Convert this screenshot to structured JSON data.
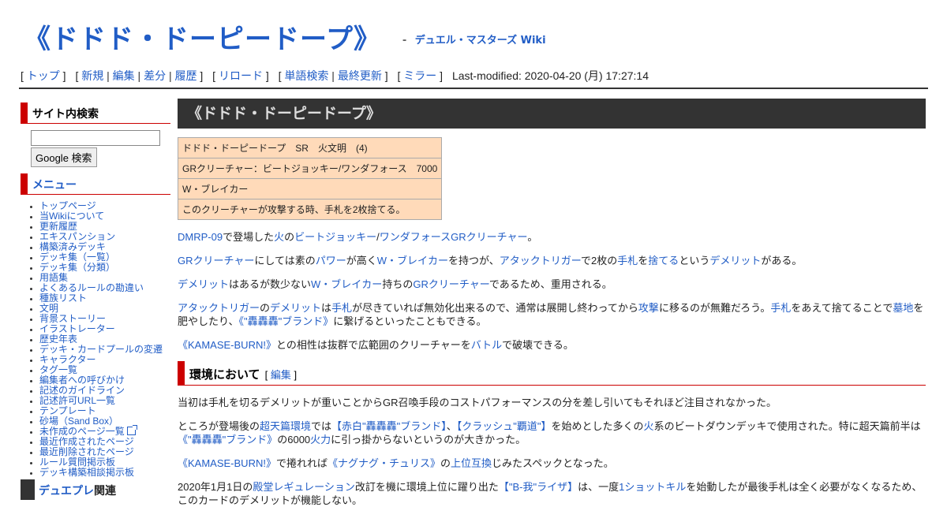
{
  "site": {
    "page_title": "《ドドド・ドーピードープ》",
    "dash": "-",
    "wiki_name": "デュエル・マスターズ Wiki"
  },
  "navbar": {
    "top": "トップ",
    "new": "新規",
    "edit": "編集",
    "diff": "差分",
    "history": "履歴",
    "reload": "リロード",
    "word_search": "単語検索",
    "recent": "最終更新",
    "mirror": "ミラー",
    "last_modified": "Last-modified: 2020-04-20 (月) 17:27:14"
  },
  "sidebar": {
    "search_heading": "サイト内検索",
    "search_value": "",
    "search_button": "Google 検索",
    "menu_heading": "メニュー",
    "menu_items": [
      "トップページ",
      "当Wikiについて",
      "更新履歴",
      "エキスパンション",
      "構築済みデッキ",
      "デッキ集（一覧）",
      "デッキ集（分類）",
      "用語集",
      "よくあるルールの勘違い",
      "種族リスト",
      "文明",
      "背景ストーリー",
      "イラストレーター",
      "歴史年表",
      "デッキ・カードプールの変遷",
      "キャラクター",
      "タグ一覧",
      "編集者への呼びかけ",
      "記述のガイドライン",
      "記述許可URL一覧",
      "テンプレート",
      "砂場（Sand Box）",
      "未作成のページ一覧",
      "最近作成されたページ",
      "最近削除されたページ",
      "ルール質問掲示板",
      "デッキ構築相談掲示板"
    ],
    "related_link": "デュエプレ",
    "related_suffix": "関連"
  },
  "main": {
    "heading": "《ドドド・ドーピードープ》",
    "card_rows": [
      "ドドド・ドーピードープ　SR　火文明　(4)",
      "GRクリーチャー：ビートジョッキー/ワンダフォース　7000",
      "W・ブレイカー",
      "このクリーチャーが攻撃する時、手札を2枚捨てる。"
    ],
    "p1": {
      "a1": "DMRP-09",
      "t1": "で登場した",
      "a2": "火",
      "t2": "の",
      "a3": "ビートジョッキー",
      "t3": "/",
      "a4": "ワンダフォース",
      "a5": "GRクリーチャー",
      "t4": "。"
    },
    "p2": {
      "a1": "GRクリーチャー",
      "t1": "にしては素の",
      "a2": "パワー",
      "t2": "が高く",
      "a3": "W・ブレイカー",
      "t3": "を持つが、",
      "a4": "アタックトリガー",
      "t4": "で2枚の",
      "a5": "手札",
      "t5": "を",
      "a6": "捨てる",
      "t6": "という",
      "a7": "デメリット",
      "t7": "がある。"
    },
    "p3": {
      "a1": "デメリット",
      "t1": "はあるが数少ない",
      "a2": "W・ブレイカー",
      "t2": "持ちの",
      "a3": "GRクリーチャー",
      "t3": "であるため、重用される。"
    },
    "p4": {
      "a1": "アタックトリガー",
      "t1": "の",
      "a2": "デメリット",
      "t2": "は",
      "a3": "手札",
      "t3": "が尽きていれば無効化出来るので、通常は展開し終わってから",
      "a4": "攻撃",
      "t4": "に移るのが無難だろう。",
      "a5": "手札",
      "t5": "をあえて捨てることで",
      "a6": "墓地",
      "t6": "を肥やしたり、",
      "a7": "《\"轟轟轟\"ブランド》",
      "t7": "に繋げるといったこともできる。"
    },
    "p5": {
      "a1": "《KAMASE-BURN!》",
      "t1": "との相性は抜群で広範囲のクリーチャーを",
      "a2": "バトル",
      "t2": "で破壊できる。"
    },
    "section": {
      "title": "環境において",
      "edit_open": "[",
      "edit_label": "編集",
      "edit_close": "]"
    },
    "s1": "当初は手札を切るデメリットが重いことからGR召喚手段のコストパフォーマンスの分を差し引いてもそれほど注目されなかった。",
    "s2": {
      "t1": "ところが登場後の",
      "a1": "超天篇環境",
      "t2": "では",
      "a2": "【赤白\"轟轟轟\"ブランド】",
      "t3": "、",
      "a3": "【クラッシュ\"覇道\"】",
      "t4": "を始めとした多くの",
      "a4": "火",
      "t5": "系のビートダウンデッキで使用された。特に超天篇前半は",
      "a5": "《\"轟轟轟\"ブランド》",
      "t6": "の6000",
      "a6": "火力",
      "t7": "に引っ掛からないというのが大きかった。"
    },
    "s3": {
      "a1": "《KAMASE-BURN!》",
      "t1": "で捲れれば",
      "a2": "《ナグナグ・チュリス》",
      "t2": "の",
      "a3": "上位互換",
      "t3": "じみたスペックとなった。"
    },
    "s4": {
      "t1": "2020年1月1日の",
      "a1": "殿堂レギュレーション",
      "t2": "改訂を機に環境上位に躍り出た",
      "a2": "【\"B-我\"ライザ】",
      "t3": "は、一度",
      "a3": "1ショットキル",
      "t4": "を始動したが最後手札は全く必要がなくなるため、このカードのデメリットが機能しない。"
    }
  },
  "colors": {
    "link": "#215dc6",
    "accent": "#cc0000",
    "card_bg": "#ffdab9",
    "title_bar": "#333333"
  }
}
